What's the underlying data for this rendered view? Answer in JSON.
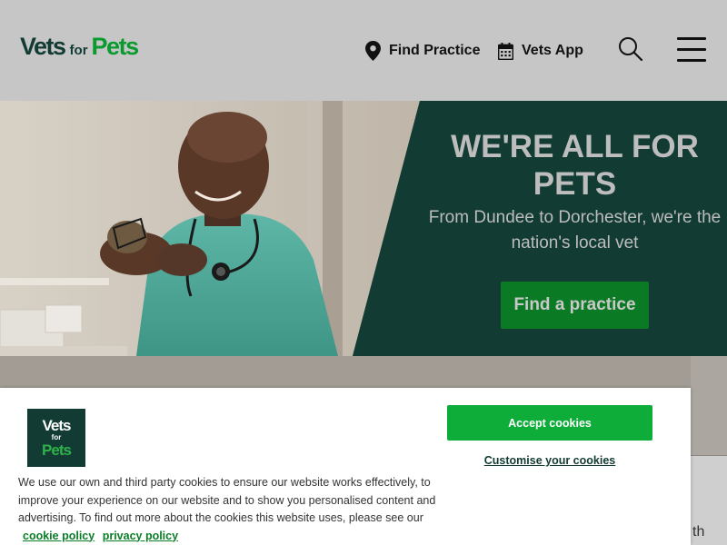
{
  "header": {
    "logo": {
      "vets": "Vets",
      "for": "for",
      "pets": "Pets"
    },
    "nav": {
      "find_practice": "Find Practice",
      "vets_app": "Vets App"
    },
    "icons": {
      "find_practice": "map-pin-icon",
      "vets_app": "calendar-icon",
      "search": "search-icon",
      "menu": "hamburger-menu-icon"
    }
  },
  "hero": {
    "title": "WE'RE ALL FOR PETS",
    "subtitle": "From Dundee to Dorchester, we're the nation's local vet",
    "cta": "Find a practice"
  },
  "partial_text": "th",
  "cookie_banner": {
    "logo": {
      "line1": "Vets",
      "line2": "for",
      "line3": "Pets"
    },
    "text": "We use our own and third party cookies to ensure our website works effectively, to improve your experience on our website and to show you personalised content and advertising. To find out more about the cookies this website uses, please see our",
    "cookie_policy_link": "cookie policy",
    "privacy_policy_link": "privacy policy",
    "accept_button": "Accept cookies",
    "customise_link": "Customise your cookies"
  },
  "colors": {
    "header_bg": "#c6c6c6",
    "brand_dark": "#123b33",
    "brand_green": "#0a9a2f",
    "cta_green": "#0b7a24",
    "accept_green": "#0eac38"
  }
}
